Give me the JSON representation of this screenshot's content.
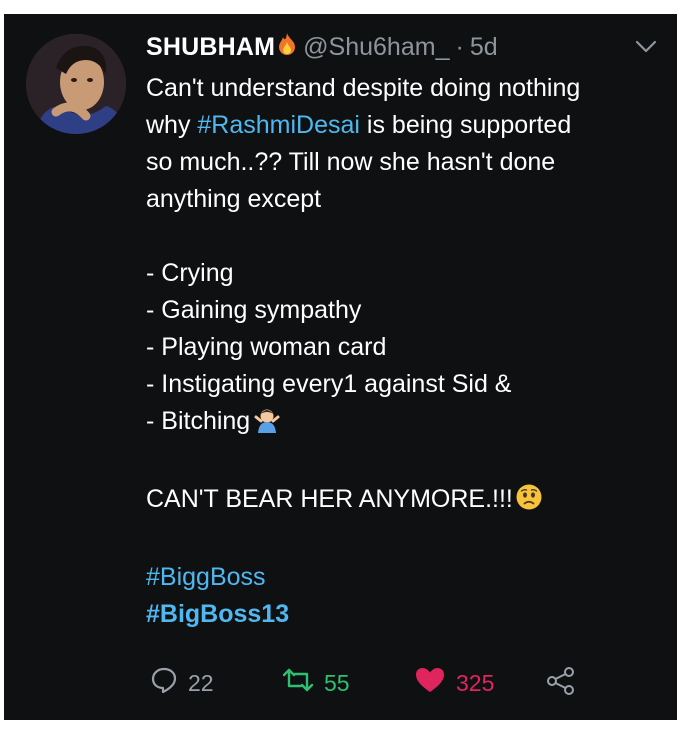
{
  "tweet": {
    "display_name": "SHUBHAM",
    "handle": "@Shu6ham_",
    "separator": "·",
    "time": "5d",
    "lines": [
      {
        "text": "Can't understand despite doing nothing"
      },
      {
        "prefix": "why ",
        "tag": "#RashmiDesai",
        "suffix": " is being supported"
      },
      {
        "text": "so much..?? Till now she hasn't done"
      },
      {
        "text": "anything except"
      },
      {
        "text": "- Crying"
      },
      {
        "text": "- Gaining sympathy"
      },
      {
        "text": "- Playing woman card"
      },
      {
        "text": "- Instigating every1 against Sid &"
      },
      {
        "text": "- Bitching"
      },
      {
        "text": "CAN'T BEAR HER ANYMORE.!!!"
      }
    ],
    "hashtags": [
      "#BiggBoss",
      "#BigBoss13"
    ]
  },
  "actions": {
    "reply_count": "22",
    "retweet_count": "55",
    "like_count": "325"
  },
  "icons": {
    "name_emoji": "fire-emoji",
    "bitching_emoji": "person-shrugging-emoji",
    "anymore_emoji": "worried-face-emoji",
    "menu": "chevron-down-icon",
    "reply": "reply-icon",
    "retweet": "retweet-icon",
    "like": "heart-icon",
    "share": "share-icon"
  },
  "colors": {
    "background": "#0f1012",
    "text": "#ffffff",
    "muted": "#8e959c",
    "link": "#4fb8f0",
    "retweet": "#2fbf71",
    "like": "#e0245e"
  }
}
